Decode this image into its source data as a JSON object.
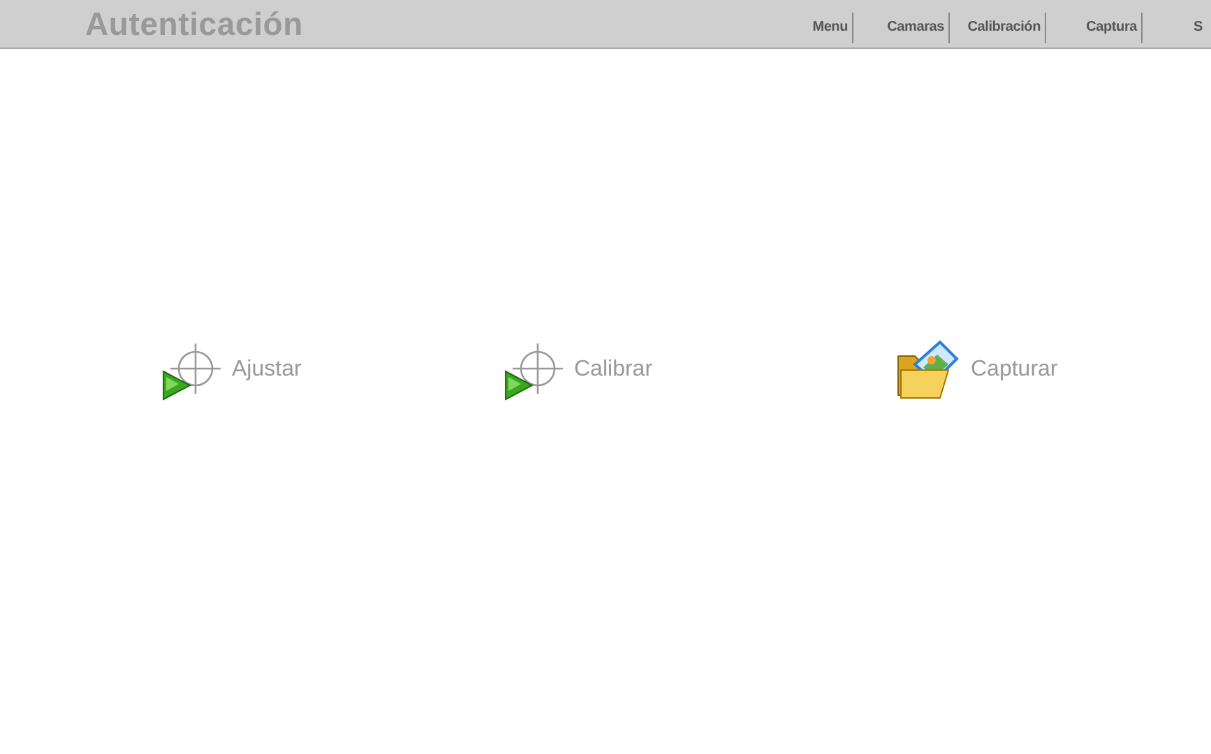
{
  "header": {
    "title": "Autenticación"
  },
  "nav": [
    {
      "label": "Menu"
    },
    {
      "label": "Camaras"
    },
    {
      "label": "Calibración"
    },
    {
      "label": "Captura"
    },
    {
      "label": "S"
    }
  ],
  "actions": [
    {
      "label": "Ajustar",
      "kind": "target"
    },
    {
      "label": "Calibrar",
      "kind": "target"
    },
    {
      "label": "Capturar",
      "kind": "folder"
    }
  ]
}
